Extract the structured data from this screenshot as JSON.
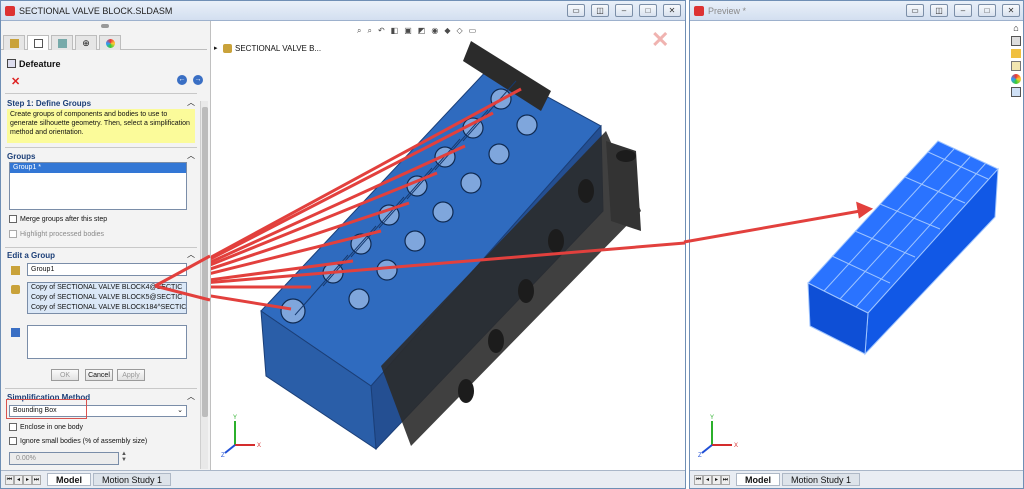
{
  "main_window": {
    "title": "SECTIONAL VALVE BLOCK.SLDASM",
    "tree_root": "SECTIONAL VALVE B..."
  },
  "property_manager": {
    "title": "Defeature",
    "step1": {
      "heading": "Step 1: Define Groups",
      "instructions": "Create groups of components and bodies to use to generate silhouette geometry. Then, select a simplification method and orientation."
    },
    "groups": {
      "heading": "Groups",
      "items": [
        "Group1 *"
      ],
      "merge_label": "Merge groups after this step",
      "highlight_label": "Highlight processed bodies"
    },
    "edit_group": {
      "heading": "Edit a Group",
      "name_value": "Group1",
      "components": [
        "Copy of SECTIONAL VALVE BLOCK4@SECTIC",
        "Copy of SECTIONAL VALVE BLOCK5@SECTIC",
        "Copy of SECTIONAL VALVE BLOCK184^SECTIC"
      ],
      "ok_label": "OK",
      "cancel_label": "Cancel",
      "apply_label": "Apply"
    },
    "simplification": {
      "heading": "Simplification Method",
      "method_value": "Bounding Box",
      "enclose_label": "Enclose in one body",
      "ignore_label": "Ignore small bodies (% of assembly size)",
      "percent_value": "0.00%"
    }
  },
  "preview_window": {
    "title": "Preview *"
  },
  "bottom_tabs": {
    "model": "Model",
    "motion": "Motion Study 1"
  },
  "axes": {
    "x": "X",
    "y": "Y",
    "z": "Z"
  },
  "colors": {
    "model_blue": "#2f6bbf",
    "preview_blue": "#1560ff",
    "callout_red": "#e2403d",
    "instruction_bg": "#fbfb9a",
    "highlight_box": "#d9534f"
  }
}
